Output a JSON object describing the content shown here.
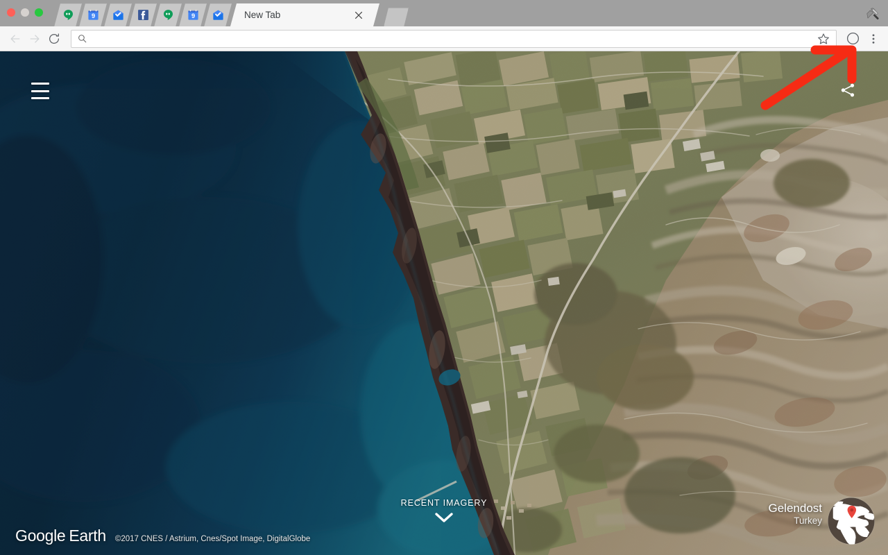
{
  "browser": {
    "window_controls": [
      "close",
      "minimize",
      "zoom"
    ],
    "tools_icon": "hammer-wrench-icon",
    "tabs": [
      {
        "favicon": "hangouts-icon",
        "title": "Hangouts",
        "active": false
      },
      {
        "favicon": "calendar-icon",
        "title": "Google Calendar",
        "active": false,
        "badge": "9"
      },
      {
        "favicon": "inbox-icon",
        "title": "Inbox",
        "active": false
      },
      {
        "favicon": "facebook-icon",
        "title": "Facebook",
        "active": false
      },
      {
        "favicon": "hangouts-icon",
        "title": "Hangouts",
        "active": false
      },
      {
        "favicon": "calendar-icon",
        "title": "Google Calendar",
        "active": false,
        "badge": "9"
      },
      {
        "favicon": "inbox-icon",
        "title": "Inbox",
        "active": false
      }
    ],
    "active_tab": {
      "title": "New Tab",
      "close_label": "×"
    },
    "new_tab_button": "new-tab-button",
    "toolbar": {
      "back": "back-button",
      "forward": "forward-button",
      "reload": "reload-button",
      "omnibox": {
        "value": "",
        "placeholder": "",
        "icon": "search-icon"
      },
      "bookmark": "star-icon",
      "profile": "profile-avatar-icon",
      "menu": "three-dot-menu-icon"
    }
  },
  "earth": {
    "menu_button": "hamburger-menu",
    "share_button": "share-icon",
    "recent_imagery": {
      "label": "RECENT IMAGERY",
      "chevron": "chevron-down-icon"
    },
    "logo": {
      "google": "Google",
      "earth": "Earth"
    },
    "copyright": "©2017 CNES / Astrium, Cnes/Spot Image, DigitalGlobe",
    "place": {
      "city": "Gelendost",
      "country": "Turkey"
    },
    "globe": {
      "name": "globe-thumbnail",
      "pin": "location-pin"
    }
  },
  "annotation": {
    "arrow": {
      "color": "#f62b14",
      "points_to": "profile-avatar-icon"
    }
  },
  "colors": {
    "titlebar": "#a0a0a0",
    "tab_inactive": "#c8c8c8",
    "tab_active": "#f6f6f6",
    "toolbar": "#f6f6f6",
    "deep_water": "#0a2538",
    "shallow_water": "#146d87",
    "farmland_green": "#6f7a52",
    "farmland_tan": "#c3b496",
    "cliff_dark": "#3a2b2a",
    "mountain_brown": "#8a7358",
    "rock_grey": "#cdc4bb",
    "annotation_red": "#f62b14"
  }
}
